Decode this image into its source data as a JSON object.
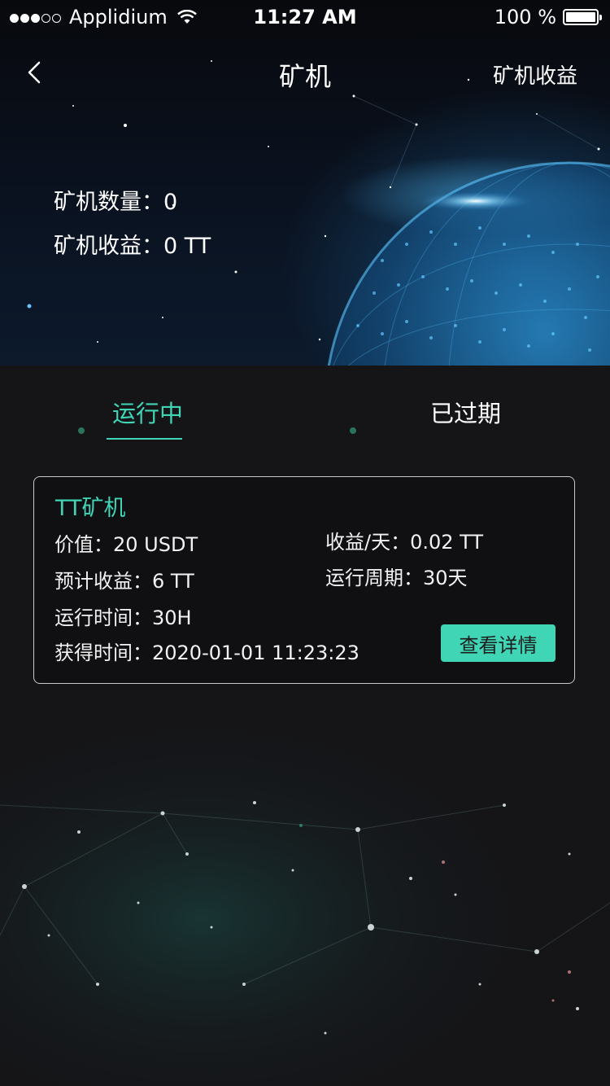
{
  "status_bar": {
    "carrier": "Applidium",
    "signal_dots_filled": 3,
    "signal_dots_total": 5,
    "time": "11:27 AM",
    "battery": "100 %"
  },
  "nav": {
    "back_icon": "chevron-left-icon",
    "title": "矿机",
    "action_label": "矿机收益"
  },
  "summary": {
    "count_label": "矿机数量：",
    "count_value": "0",
    "income_label": "矿机收益：",
    "income_value": "0 TT"
  },
  "tabs": [
    {
      "label": "运行中",
      "active": true
    },
    {
      "label": "已过期",
      "active": false
    }
  ],
  "miner_card": {
    "title": "TT矿机",
    "value": "价值：20 USDT",
    "daily_income": "收益/天：0.02 TT",
    "expected_income": "预计收益：6 TT",
    "cycle": "运行周期：30天",
    "runtime": "运行时间：30H",
    "acquired_time": "获得时间：2020-01-01 11:23:23",
    "detail_button": "查看详情"
  },
  "colors": {
    "accent": "#3fd5b5",
    "background": "#151518",
    "card_border": "#c9c9c9"
  }
}
